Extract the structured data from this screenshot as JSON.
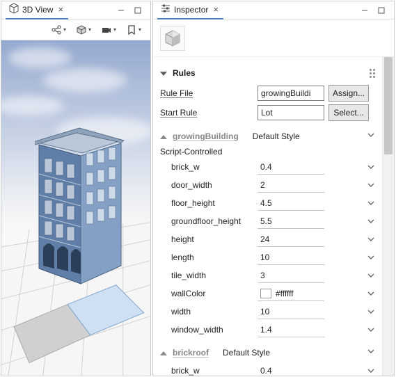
{
  "left_panel": {
    "title": "3D View"
  },
  "right_panel": {
    "title": "Inspector"
  },
  "rules_section": {
    "title": "Rules",
    "rule_file_label": "Rule File",
    "rule_file_value": "growingBuildi",
    "start_rule_label": "Start Rule",
    "start_rule_value": "Lot",
    "assign_label": "Assign...",
    "select_label": "Select..."
  },
  "growing": {
    "title": "growingBuilding",
    "style": "Default Style",
    "script_label": "Script-Controlled",
    "attrs": [
      {
        "name": "brick_w",
        "value": "0.4"
      },
      {
        "name": "door_width",
        "value": "2"
      },
      {
        "name": "floor_height",
        "value": "4.5"
      },
      {
        "name": "groundfloor_height",
        "value": "5.5"
      },
      {
        "name": "height",
        "value": "24"
      },
      {
        "name": "length",
        "value": "10"
      },
      {
        "name": "tile_width",
        "value": "3"
      },
      {
        "name": "wallColor",
        "value": "#ffffff"
      },
      {
        "name": "width",
        "value": "10"
      },
      {
        "name": "window_width",
        "value": "1.4"
      }
    ]
  },
  "brickroof": {
    "title": "brickroof",
    "style": "Default Style",
    "attrs": [
      {
        "name": "brick_w",
        "value": "0.4"
      }
    ]
  }
}
